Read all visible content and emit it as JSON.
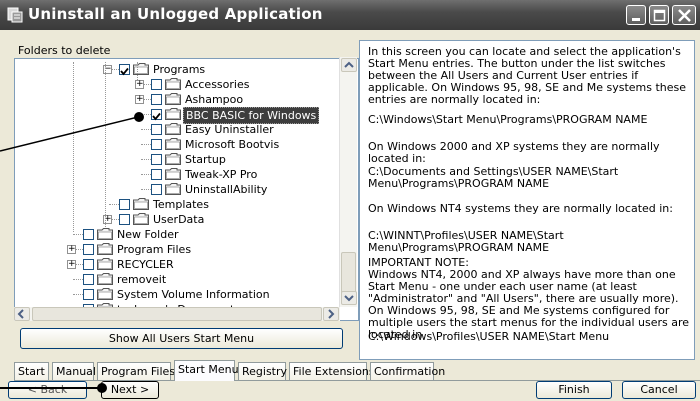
{
  "window": {
    "title": "Uninstall an Unlogged Application",
    "accent": "#3d3d3d"
  },
  "left_pane": {
    "label": "Folders to delete",
    "tree": [
      {
        "label": "Programs",
        "level": 3,
        "expander": "-",
        "checked": true
      },
      {
        "label": "Accessories",
        "level": 4,
        "expander": "+",
        "checked": false
      },
      {
        "label": "Ashampoo",
        "level": 4,
        "expander": "+",
        "checked": false
      },
      {
        "label": "BBC BASIC for Windows",
        "level": 4,
        "expander": "",
        "checked": true,
        "selected": true
      },
      {
        "label": "Easy Uninstaller",
        "level": 4,
        "expander": "",
        "checked": false
      },
      {
        "label": "Microsoft Bootvis",
        "level": 4,
        "expander": "",
        "checked": false
      },
      {
        "label": "Startup",
        "level": 4,
        "expander": "",
        "checked": false
      },
      {
        "label": "Tweak-XP Pro",
        "level": 4,
        "expander": "",
        "checked": false
      },
      {
        "label": "UninstallAbility",
        "level": 4,
        "expander": "",
        "checked": false
      },
      {
        "label": "Templates",
        "level": 3,
        "expander": "",
        "checked": false
      },
      {
        "label": "UserData",
        "level": 3,
        "expander": "+",
        "checked": false
      },
      {
        "label": "New Folder",
        "level": 2,
        "expander": "",
        "checked": false
      },
      {
        "label": "Program Files",
        "level": 2,
        "expander": "+",
        "checked": false
      },
      {
        "label": "RECYCLER",
        "level": 2,
        "expander": "+",
        "checked": false
      },
      {
        "label": "removeit",
        "level": 2,
        "expander": "",
        "checked": false
      },
      {
        "label": "System Volume Information",
        "level": 2,
        "expander": "",
        "checked": false
      },
      {
        "label": "techuser's Documents",
        "level": 2,
        "expander": "",
        "checked": false
      }
    ],
    "show_all_button": "Show All Users Start Menu"
  },
  "right_pane": {
    "paragraphs": [
      "In this screen you can locate and select the application's Start Menu entries. The button under the list switches between the All Users and Current User entries if applicable. On Windows 95, 98, SE and Me systems these entries are normally located in:",
      "C:\\Windows\\Start Menu\\Programs\\PROGRAM NAME",
      "On Windows 2000 and XP systems they are normally located in:",
      "C:\\Documents and Settings\\USER NAME\\Start Menu\\Programs\\PROGRAM NAME",
      "On Windows NT4 systems they are normally located in:",
      "C:\\WINNT\\Profiles\\USER NAME\\Start Menu\\Programs\\PROGRAM NAME",
      "IMPORTANT NOTE:\nWindows NT4, 2000 and XP always have more than one Start Menu - one under each user name (at least \"Administrator\" and \"All Users\", there are usually more). On Windows 95, 98, SE and Me systems configured for multiple users the start menus for the individual users are located in",
      "C:\\Windows\\Profiles\\USER NAME\\Start Menu"
    ]
  },
  "tabs": [
    "Start",
    "Manual",
    "Program Files",
    "Start Menu",
    "Registry",
    "File Extensions",
    "Confirmation"
  ],
  "active_tab": "Start Menu",
  "buttons": {
    "back": "< Back",
    "next": "Next >",
    "finish": "Finish",
    "cancel": "Cancel"
  }
}
